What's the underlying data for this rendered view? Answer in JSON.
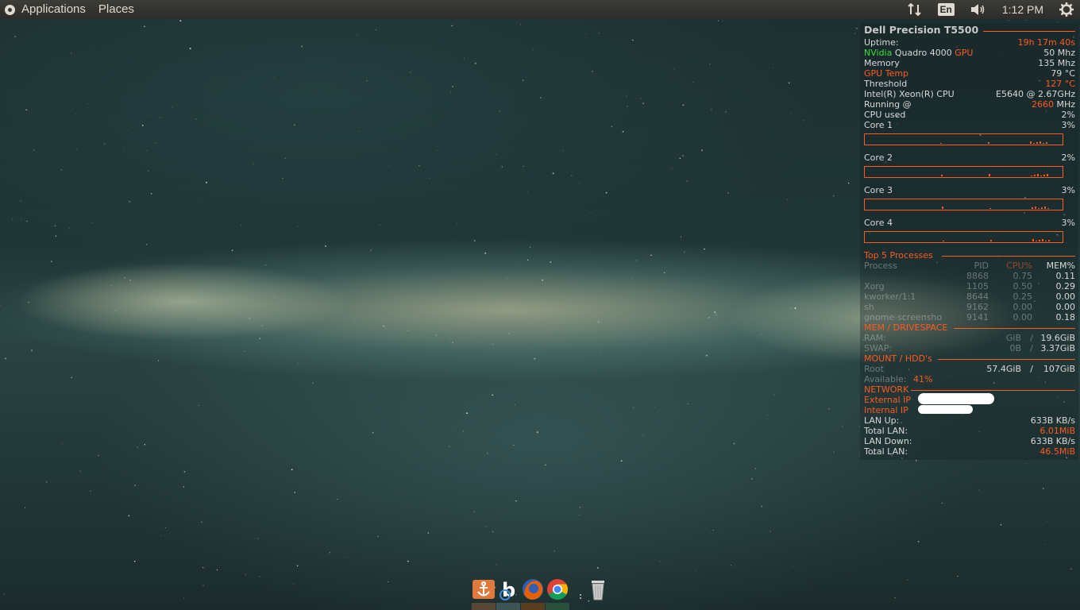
{
  "top_panel": {
    "menus": [
      "Applications",
      "Places"
    ],
    "lang": "En",
    "clock": "1:12 PM",
    "icons": [
      "network-arrows-icon",
      "volume-icon",
      "power-gear-icon"
    ]
  },
  "conky": {
    "title": "Dell Precision T5500",
    "uptime_label": "Uptime:",
    "uptime_value": "19h 17m 40s",
    "gpu_vendor": "NVidia",
    "gpu_model": " Quadro 4000 ",
    "gpu_word": "GPU",
    "gpu_freq": "50 Mhz",
    "memory_label": "Memory",
    "memory_value": "135 Mhz",
    "gpu_temp_label": "GPU Temp",
    "gpu_temp_value": "79 °C",
    "threshold_label": "Threshold",
    "threshold_value": "127 °C",
    "cpu_name": "Intel(R) Xeon(R) CPU",
    "cpu_model": "E5640  @ 2.67GHz",
    "running_label": "Running @",
    "running_value": "2660",
    "running_unit": " MHz",
    "cpu_used_label": "CPU used",
    "cpu_used_value": "2%",
    "cores": [
      {
        "label": "Core 1",
        "value": "3%"
      },
      {
        "label": "Core 2",
        "value": "2%"
      },
      {
        "label": "Core 3",
        "value": "3%"
      },
      {
        "label": "Core 4",
        "value": "3%"
      }
    ],
    "top5_header": "Top 5 Processes",
    "proc_headers": {
      "name": "Process",
      "pid": "PID",
      "cpu": "CPU%",
      "mem": "MEM%"
    },
    "processes": [
      {
        "name": "",
        "pid": "8868",
        "cpu": "0.75",
        "mem": "0.11"
      },
      {
        "name": "Xorg",
        "pid": "1105",
        "cpu": "0.50",
        "mem": "0.29"
      },
      {
        "name": "kworker/1:1",
        "pid": "8644",
        "cpu": "0.25",
        "mem": "0.00"
      },
      {
        "name": "sh",
        "pid": "9162",
        "cpu": "0.00",
        "mem": "0.00"
      },
      {
        "name": "gnome-screensho",
        "pid": "9141",
        "cpu": "0.00",
        "mem": "0.18"
      }
    ],
    "mem_header": "MEM / DRIVESPACE",
    "ram_label": "RAM:",
    "ram_used": "GiB",
    "ram_sep": "/",
    "ram_total": "19.6GiB",
    "swap_label": "SWAP:",
    "swap_used": "0B",
    "swap_sep": "/",
    "swap_total": "3.37GiB",
    "mount_header": "MOUNT / HDD's",
    "root_label": "Root",
    "root_used": "57.4GiB",
    "root_sep": "/",
    "root_total": "107GiB",
    "available_label": "Available:",
    "available_value": "41%",
    "network_header": "NETWORK",
    "external_ip_label": "External IP",
    "internal_ip_label": "Internal IP",
    "lan_up_label": "LAN Up:",
    "lan_up_value": "633B  KB/s",
    "total_lan_label": "Total LAN:",
    "total_lan_up_value": "6.01MiB",
    "lan_down_label": "LAN Down:",
    "lan_down_value": "633B  KB/s",
    "total_lan_down_value": "46.5MiB"
  },
  "dock": {
    "icons": [
      "anchor-icon",
      "b-app-icon",
      "firefox-icon",
      "chrome-icon",
      "trash-icon"
    ]
  }
}
